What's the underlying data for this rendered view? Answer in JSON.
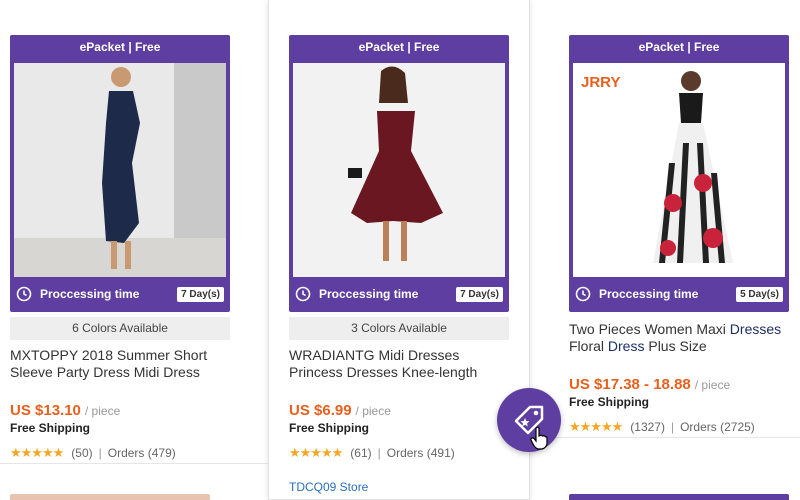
{
  "colors": {
    "accent": "#5e3ea0",
    "price": "#e8601f",
    "star": "#f5a623",
    "link": "#2a6fb8"
  },
  "products": [
    {
      "badge": "ePacket | Free",
      "processing_label": "Proccessing time",
      "processing_days": "7 Day(s)",
      "colors_available": "6 Colors Available",
      "title": "MXTOPPY 2018 Summer Short Sleeve Party Dress Midi Dress",
      "price": "US $13.10",
      "price_unit": "/ piece",
      "shipping": "Free Shipping",
      "reviews": "(50)",
      "sep": "|",
      "orders": "Orders (479)",
      "stars": "★★★★★"
    },
    {
      "badge": "ePacket | Free",
      "processing_label": "Proccessing time",
      "processing_days": "7 Day(s)",
      "colors_available": "3 Colors Available",
      "title": "WRADIANTG Midi Dresses Princess Dresses Knee-length",
      "price": "US $6.99",
      "price_unit": "/ piece",
      "shipping": "Free Shipping",
      "reviews": "(61)",
      "sep": "|",
      "orders": "Orders (491)",
      "stars": "★★★★★",
      "store": "TDCQ09 Store"
    },
    {
      "badge": "ePacket | Free",
      "processing_label": "Proccessing time",
      "processing_days": "5 Day(s)",
      "title_parts": [
        "Two Pieces Women Maxi ",
        "Dresses",
        " Floral ",
        "Dress",
        " Plus Size"
      ],
      "price": "US $17.38 - 18.88",
      "price_unit": "/ piece",
      "shipping": "Free Shipping",
      "reviews": "(1327)",
      "sep": "|",
      "orders": "Orders (2725)",
      "stars": "★★★★★",
      "logo_text": "JRRY"
    }
  ],
  "icons": {
    "processing": "clock-history-icon",
    "coupon": "price-tag-icon",
    "cursor": "hand-pointer-icon"
  }
}
